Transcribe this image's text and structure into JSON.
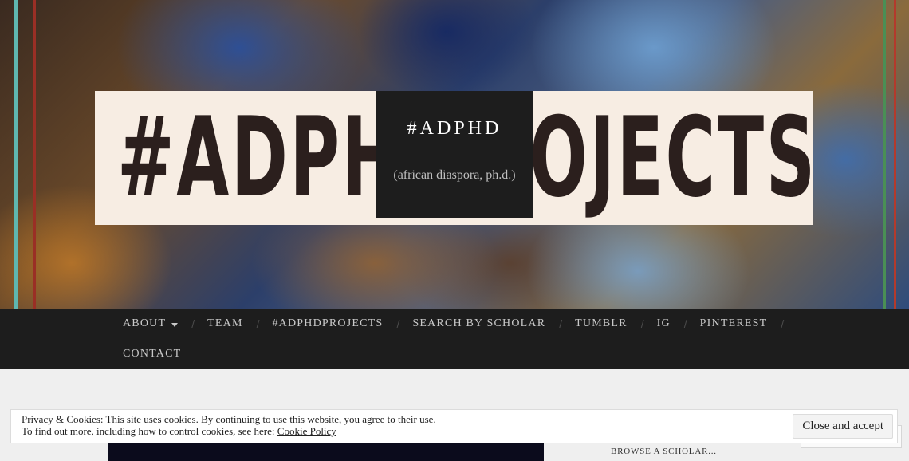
{
  "header": {
    "band_text_left": "#ADPH",
    "band_text_right": "OJECTS",
    "site_title": "#ADPHD",
    "tagline": "(african diaspora, ph.d.)"
  },
  "nav": {
    "items": [
      {
        "label": "ABOUT",
        "has_dropdown": true
      },
      {
        "label": "TEAM"
      },
      {
        "label": "#ADPHDPROJECTS"
      },
      {
        "label": "SEARCH BY SCHOLAR"
      },
      {
        "label": "TUMBLR"
      },
      {
        "label": "IG"
      },
      {
        "label": "PINTEREST"
      },
      {
        "label": "CONTACT"
      }
    ],
    "separator": "/"
  },
  "sidebar": {
    "browse_heading": "BROWSE A SCHOLAR..."
  },
  "cookie_banner": {
    "line1": "Privacy & Cookies: This site uses cookies. By continuing to use this website, you agree to their use.",
    "line2_prefix": "To find out more, including how to control cookies, see here: ",
    "link_label": "Cookie Policy",
    "accept_label": "Close and accept"
  },
  "colors": {
    "nav_bg": "#1d1d1d",
    "band_bg": "#f7ede3",
    "band_text": "#2b1f1d",
    "page_bg": "#efefef"
  }
}
